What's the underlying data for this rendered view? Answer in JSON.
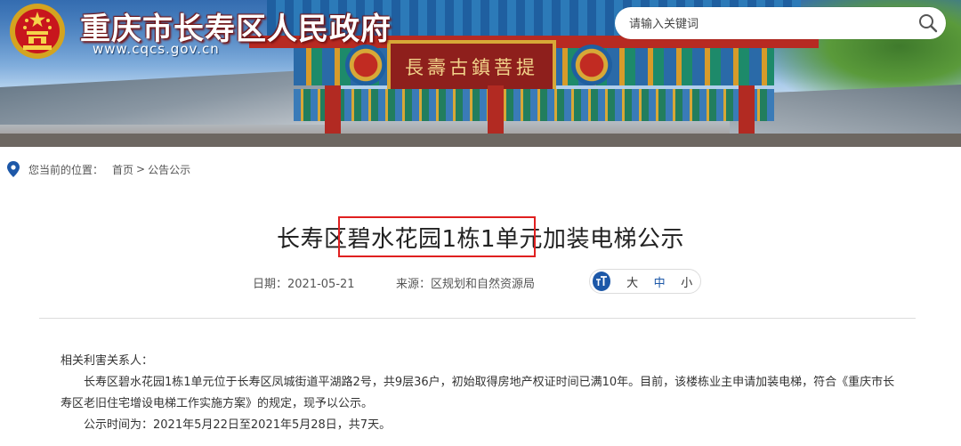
{
  "header": {
    "site_title": "重庆市长寿区人民政府",
    "site_url": "www.cqcs.gov.cn",
    "gate_plaque": "長壽古鎮菩提",
    "search": {
      "placeholder": "请输入关键词"
    }
  },
  "breadcrumb": {
    "prefix": "您当前的位置：",
    "items": [
      "首页",
      "公告公示"
    ],
    "separator": ">"
  },
  "article": {
    "title": "长寿区碧水花园1栋1单元加装电梯公示",
    "date_label": "日期：",
    "date": "2021-05-21",
    "source_label": "来源：",
    "source": "区规划和自然资源局",
    "font_size_options": [
      "大",
      "中",
      "小"
    ],
    "font_size_selected": "中",
    "paragraphs": [
      "相关利害关系人：",
      "长寿区碧水花园1栋1单元位于长寿区凤城街道平湖路2号，共9层36户，初始取得房地产权证时间已满10年。目前，该楼栋业主申请加装电梯，符合《重庆市长寿区老旧住宅增设电梯工作实施方案》的规定，现予以公示。",
      "公示时间为：2021年5月22日至2021年5月28日，共7天。"
    ]
  },
  "colors": {
    "accent_blue": "#1d58a8",
    "highlight_red": "#e02020",
    "title_shadow": "#7a1414"
  }
}
